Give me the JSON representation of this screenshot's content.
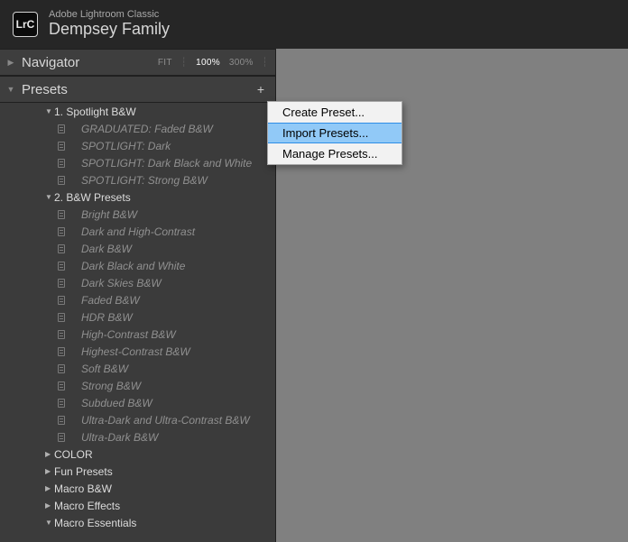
{
  "titlebar": {
    "logo_text": "LrC",
    "app_name": "Adobe Lightroom Classic",
    "project": "Dempsey Family"
  },
  "navigator": {
    "title": "Navigator",
    "fit_label": "FIT",
    "zoom1": "100%",
    "zoom2": "300%"
  },
  "presets_panel": {
    "title": "Presets",
    "add_symbol": "+"
  },
  "groups": [
    {
      "expanded": true,
      "label": "1. Spotlight B&W",
      "items": [
        "GRADUATED: Faded B&W",
        "SPOTLIGHT: Dark",
        "SPOTLIGHT: Dark Black and White",
        "SPOTLIGHT: Strong B&W"
      ]
    },
    {
      "expanded": true,
      "label": "2. B&W Presets",
      "items": [
        "Bright B&W",
        "Dark and High-Contrast",
        "Dark B&W",
        "Dark Black and White",
        "Dark Skies B&W",
        "Faded B&W",
        "HDR B&W",
        "High-Contrast B&W",
        "Highest-Contrast B&W",
        "Soft B&W",
        "Strong B&W",
        "Subdued B&W",
        "Ultra-Dark and Ultra-Contrast B&W",
        "Ultra-Dark B&W"
      ]
    },
    {
      "expanded": false,
      "label": "COLOR",
      "items": []
    },
    {
      "expanded": false,
      "label": "Fun Presets",
      "items": []
    },
    {
      "expanded": false,
      "label": "Macro B&W",
      "items": []
    },
    {
      "expanded": false,
      "label": "Macro Effects",
      "items": []
    },
    {
      "expanded": true,
      "label": "Macro Essentials",
      "items": []
    }
  ],
  "context_menu": {
    "items": [
      {
        "label": "Create Preset...",
        "hover": false
      },
      {
        "label": "Import Presets...",
        "hover": true
      },
      {
        "label": "Manage Presets...",
        "hover": false
      }
    ]
  }
}
